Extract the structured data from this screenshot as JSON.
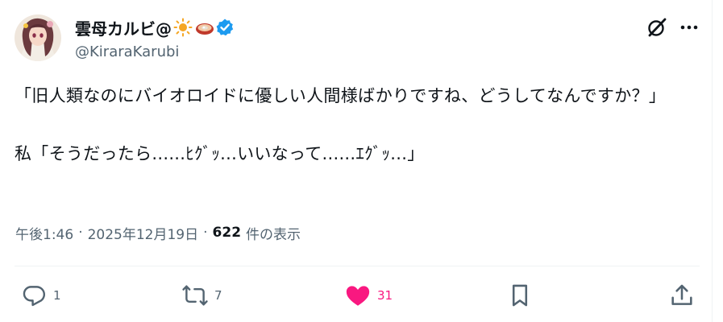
{
  "user": {
    "display_name": "雲母カルビ@",
    "handle": "@KiraraKarubi",
    "name_emojis": [
      "sun-emoji",
      "meat-on-bone-emoji"
    ],
    "verified": true
  },
  "tweet": {
    "text": "「旧人類なのにバイオロイドに優しい人間様ばかりですね、どうしてなんですか？」\n\n私「そうだったら......ﾋｸﾞｯ...いいなって......ｴｸﾞｯ...」"
  },
  "meta": {
    "time": "午後1:46",
    "separator": "·",
    "date": "2025年12月19日",
    "views_count": "622",
    "views_label": "件の表示"
  },
  "actions": {
    "replies": "1",
    "reposts": "7",
    "likes": "31",
    "liked": true
  },
  "colors": {
    "text": "#0f1419",
    "secondary": "#536471",
    "like": "#f91880",
    "verified": "#1d9bf0",
    "divider": "#eff3f4"
  },
  "icons": [
    "avatar",
    "verified-badge-icon",
    "grok-icon",
    "more-icon",
    "reply-icon",
    "repost-icon",
    "like-icon",
    "bookmark-icon",
    "share-icon"
  ]
}
